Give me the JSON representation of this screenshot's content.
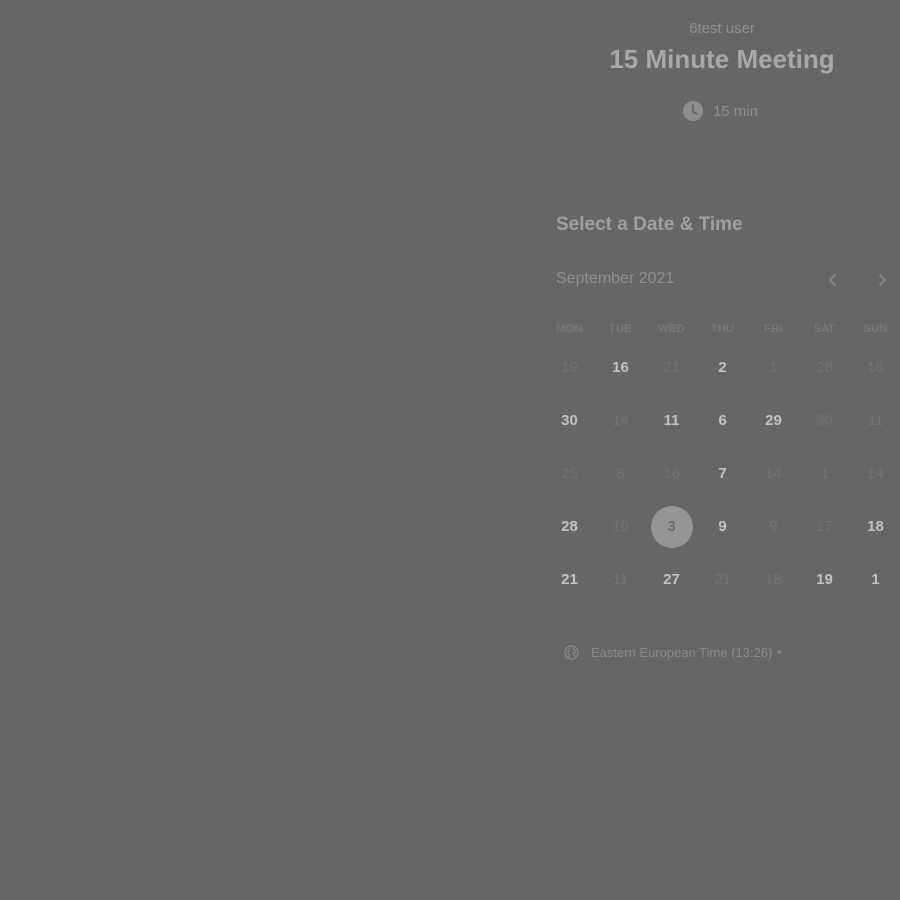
{
  "event": {
    "organizer": "6test user",
    "title": "15 Minute Meeting",
    "duration": "15 min",
    "duration_icon": "clock-icon"
  },
  "scheduler": {
    "heading": "Select a Date & Time",
    "month_label": "September 2021",
    "prev_icon": "chevron-left-icon",
    "next_icon": "chevron-right-icon",
    "weekdays": [
      "MON",
      "TUE",
      "WED",
      "THU",
      "FRI",
      "SAT",
      "SUN"
    ],
    "weeks": [
      [
        {
          "label": "19",
          "state": "disabled"
        },
        {
          "label": "16",
          "state": "available"
        },
        {
          "label": "21",
          "state": "disabled"
        },
        {
          "label": "2",
          "state": "available"
        },
        {
          "label": "1",
          "state": "disabled"
        },
        {
          "label": "28",
          "state": "disabled"
        },
        {
          "label": "16",
          "state": "disabled"
        }
      ],
      [
        {
          "label": "30",
          "state": "available"
        },
        {
          "label": "14",
          "state": "disabled"
        },
        {
          "label": "11",
          "state": "available"
        },
        {
          "label": "6",
          "state": "available"
        },
        {
          "label": "29",
          "state": "available"
        },
        {
          "label": "30",
          "state": "disabled"
        },
        {
          "label": "11",
          "state": "disabled"
        }
      ],
      [
        {
          "label": "25",
          "state": "disabled"
        },
        {
          "label": "8",
          "state": "disabled"
        },
        {
          "label": "16",
          "state": "disabled"
        },
        {
          "label": "7",
          "state": "available"
        },
        {
          "label": "14",
          "state": "disabled"
        },
        {
          "label": "1",
          "state": "disabled"
        },
        {
          "label": "14",
          "state": "disabled"
        }
      ],
      [
        {
          "label": "28",
          "state": "available"
        },
        {
          "label": "10",
          "state": "disabled"
        },
        {
          "label": "3",
          "state": "selected"
        },
        {
          "label": "9",
          "state": "available"
        },
        {
          "label": "9",
          "state": "disabled"
        },
        {
          "label": "17",
          "state": "disabled"
        },
        {
          "label": "18",
          "state": "available"
        }
      ],
      [
        {
          "label": "21",
          "state": "available"
        },
        {
          "label": "11",
          "state": "disabled"
        },
        {
          "label": "27",
          "state": "available"
        },
        {
          "label": "21",
          "state": "disabled"
        },
        {
          "label": "18",
          "state": "disabled"
        },
        {
          "label": "19",
          "state": "available"
        },
        {
          "label": "1",
          "state": "available"
        }
      ]
    ]
  },
  "timezone": {
    "label": "Eastern European Time (13:26)",
    "icon": "globe-icon",
    "caret": "▾"
  },
  "colors": {
    "overlay_background": "#666666",
    "selected_day": "#959595"
  }
}
